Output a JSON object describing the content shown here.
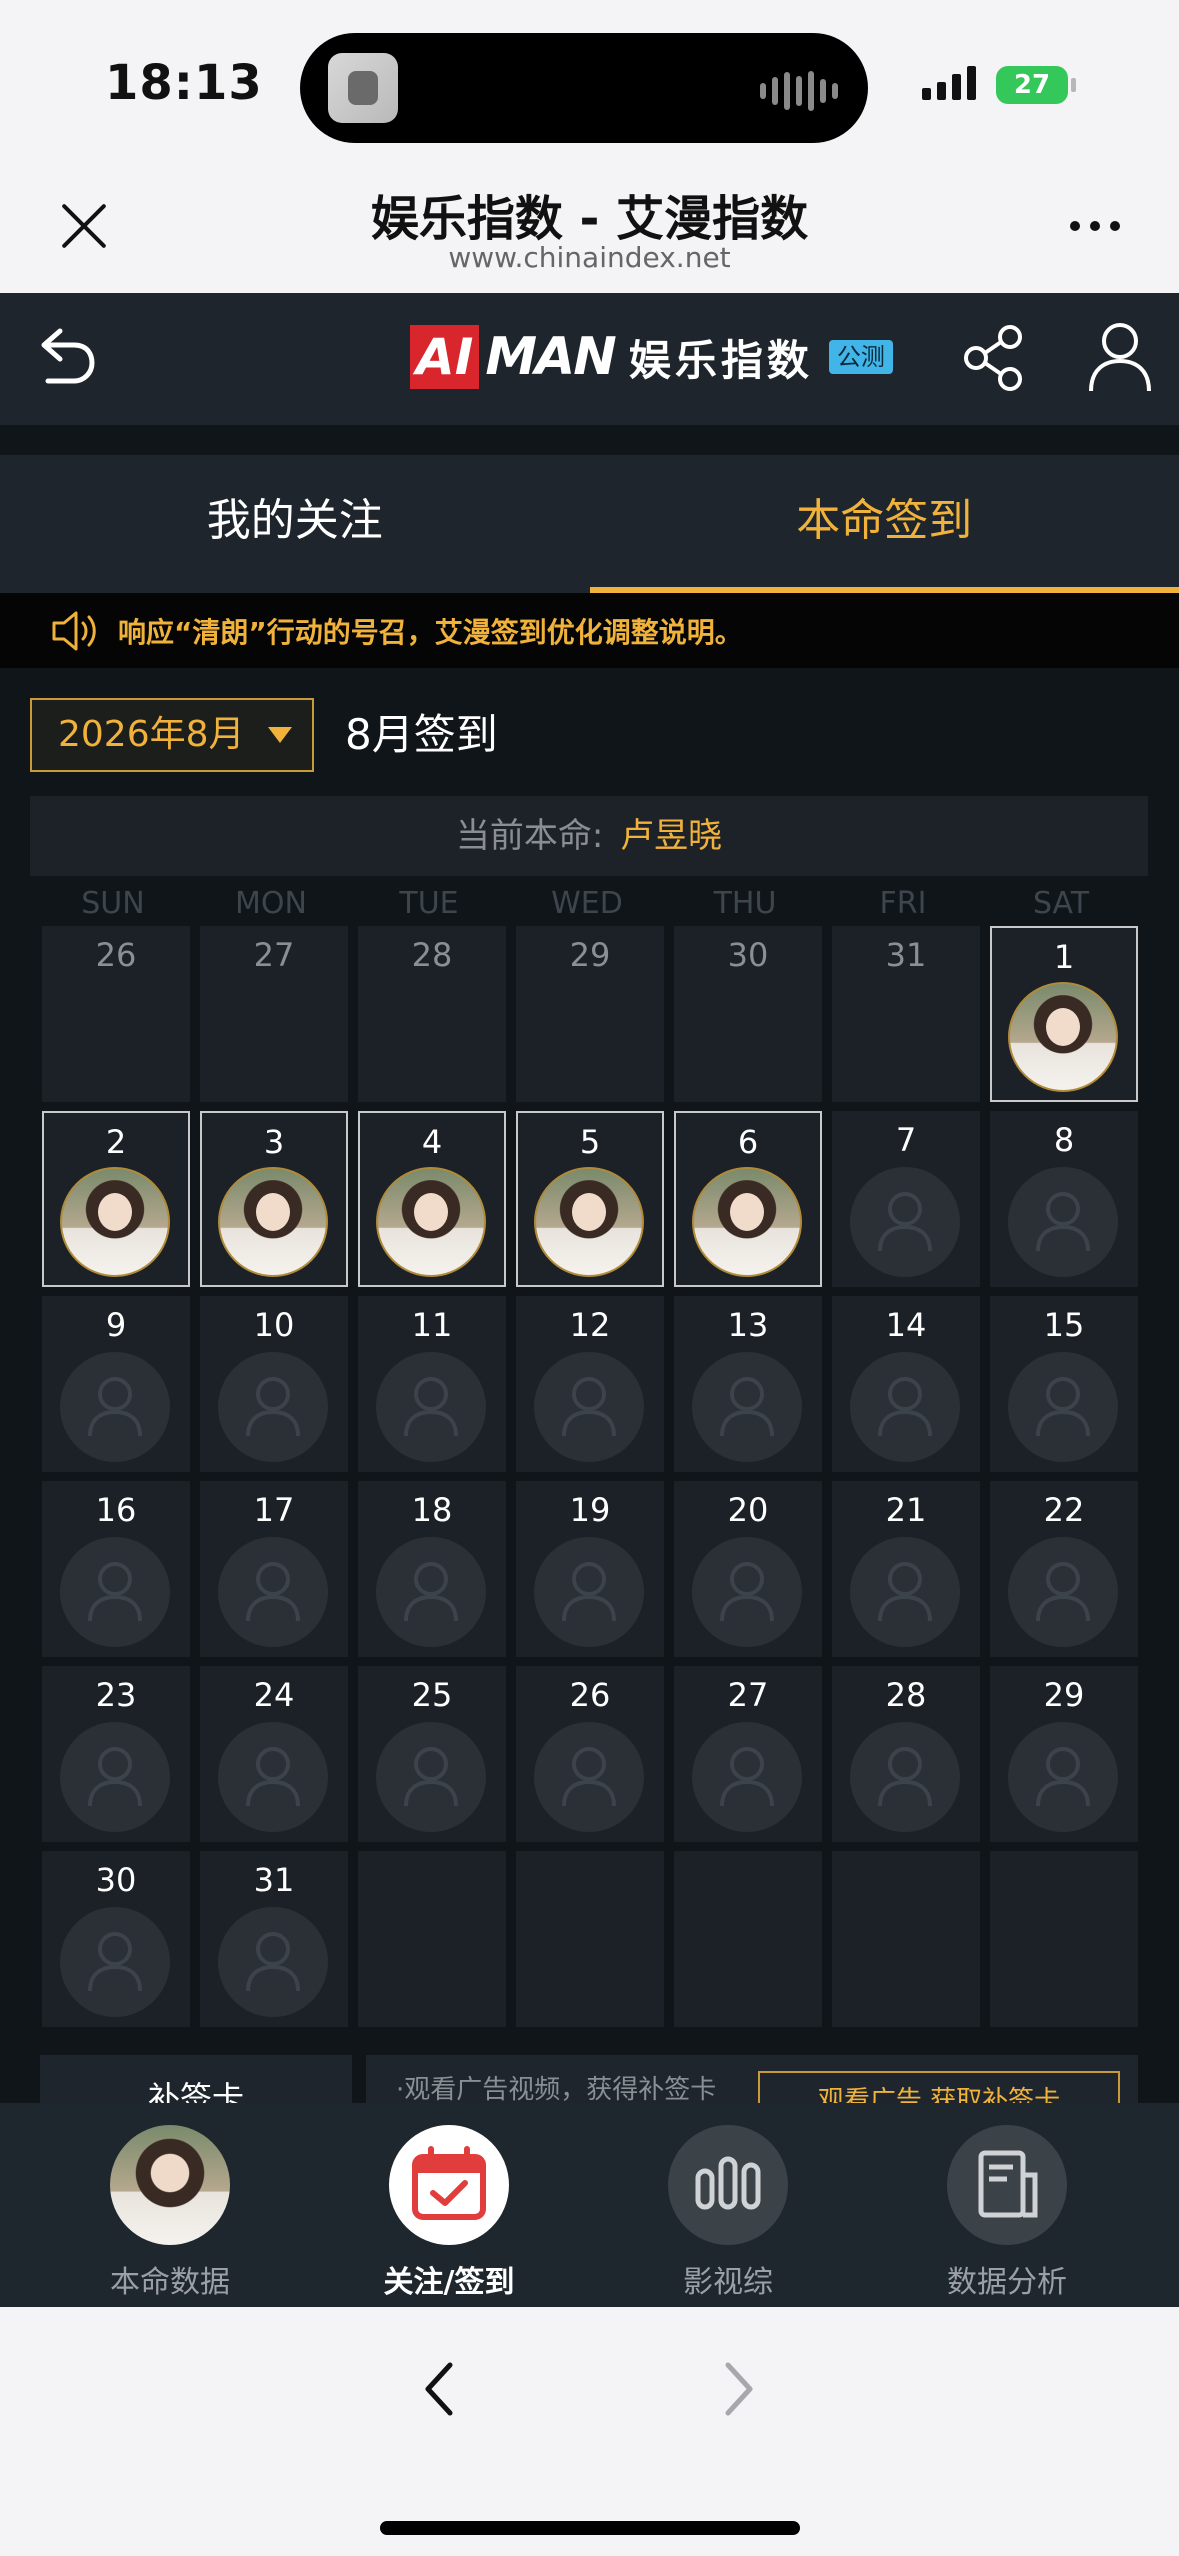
{
  "status_bar": {
    "time": "18:13",
    "battery": "27"
  },
  "browser": {
    "title": "娱乐指数 - 艾漫指数",
    "url": "www.chinaindex.net",
    "close_icon": "close-icon",
    "more_icon": "more-icon"
  },
  "app_header": {
    "logo_ai": "AI",
    "logo_man": "MAN",
    "logo_cn": "娱乐指数",
    "logo_badge": "公测"
  },
  "tabs": [
    {
      "label": "我的关注",
      "active": false
    },
    {
      "label": "本命签到",
      "active": true
    }
  ],
  "notice": {
    "text": "响应“清朗”行动的号召，艾漫签到优化调整说明。"
  },
  "month_selector": {
    "value": "2026年8月"
  },
  "month_title": "8月签到",
  "current": {
    "label": "当前本命:",
    "name": "卢昱晓"
  },
  "weekdays": [
    "SUN",
    "MON",
    "TUE",
    "WED",
    "THU",
    "FRI",
    "SAT"
  ],
  "calendar": {
    "rows": [
      [
        {
          "d": "26",
          "p": true
        },
        {
          "d": "27",
          "p": true
        },
        {
          "d": "28",
          "p": true
        },
        {
          "d": "29",
          "p": true
        },
        {
          "d": "30",
          "p": true
        },
        {
          "d": "31",
          "p": true
        },
        {
          "d": "1",
          "s": true
        }
      ],
      [
        {
          "d": "2",
          "s": true
        },
        {
          "d": "3",
          "s": true
        },
        {
          "d": "4",
          "s": true
        },
        {
          "d": "5",
          "s": true
        },
        {
          "d": "6",
          "s": true
        },
        {
          "d": "7"
        },
        {
          "d": "8"
        }
      ],
      [
        {
          "d": "9"
        },
        {
          "d": "10"
        },
        {
          "d": "11"
        },
        {
          "d": "12"
        },
        {
          "d": "13"
        },
        {
          "d": "14"
        },
        {
          "d": "15"
        }
      ],
      [
        {
          "d": "16"
        },
        {
          "d": "17"
        },
        {
          "d": "18"
        },
        {
          "d": "19"
        },
        {
          "d": "20"
        },
        {
          "d": "21"
        },
        {
          "d": "22"
        }
      ],
      [
        {
          "d": "23"
        },
        {
          "d": "24"
        },
        {
          "d": "25"
        },
        {
          "d": "26"
        },
        {
          "d": "27"
        },
        {
          "d": "28"
        },
        {
          "d": "29"
        }
      ],
      [
        {
          "d": "30"
        },
        {
          "d": "31"
        },
        {
          "d": ""
        },
        {
          "d": ""
        },
        {
          "d": ""
        },
        {
          "d": ""
        },
        {
          "d": ""
        }
      ]
    ]
  },
  "makeup": {
    "card_label": "补签卡",
    "desc": "·观看广告视频，获得补签卡",
    "button": "观看广告 获取补签卡"
  },
  "bottom_nav": [
    {
      "label": "本命数据",
      "icon": "avatar-photo",
      "active": false
    },
    {
      "label": "关注/签到",
      "icon": "calendar-check-icon",
      "active": true
    },
    {
      "label": "影视综",
      "icon": "bar-chart-icon",
      "active": false
    },
    {
      "label": "数据分析",
      "icon": "document-icon",
      "active": false
    }
  ],
  "colors": {
    "accent": "#f0b23a",
    "background": "#10151a",
    "panel": "#1e252c"
  }
}
